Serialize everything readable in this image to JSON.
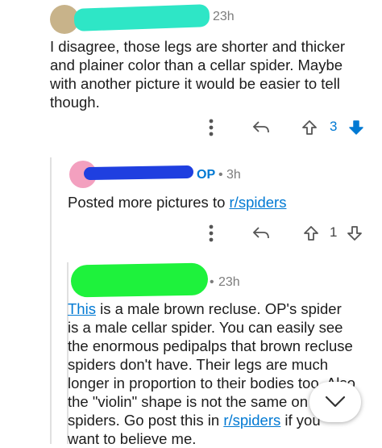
{
  "comments": [
    {
      "time": "23h",
      "text": "I disagree, those legs are shorter and thicker and plainer color than a cellar spider. Maybe with another picture it would be easier to tell though.",
      "score": "3"
    },
    {
      "badge": "OP",
      "time": "3h",
      "text_before": "Posted more pictures to ",
      "link": "r/spiders",
      "score": "1"
    },
    {
      "time": "23h",
      "link_this": "This",
      "text_lines": [
        " is a male brown recluse. OP's spider",
        "is a male cellar spider. You can easily see",
        "the enormous pedipalps that brown recluse",
        "spiders don't have. Their legs are much",
        "longer in proportion to their bodies too. Also",
        "the \"violin\" shape is not the same on cel",
        "spiders. Go post this in "
      ],
      "link_sub": "r/spiders",
      "after_link": " if you ",
      "last_line": "want to believe me."
    }
  ],
  "separator": "•",
  "colors": {
    "accent": "#0079d3",
    "redact_teal": "#2ee6c6",
    "redact_blue": "#1f3fe0",
    "redact_green": "#1ef23c",
    "avatar_pink": "#f3a0bf"
  },
  "icons": [
    "more-icon",
    "reply-icon",
    "upvote-icon",
    "downvote-icon",
    "scroll-down-icon"
  ]
}
